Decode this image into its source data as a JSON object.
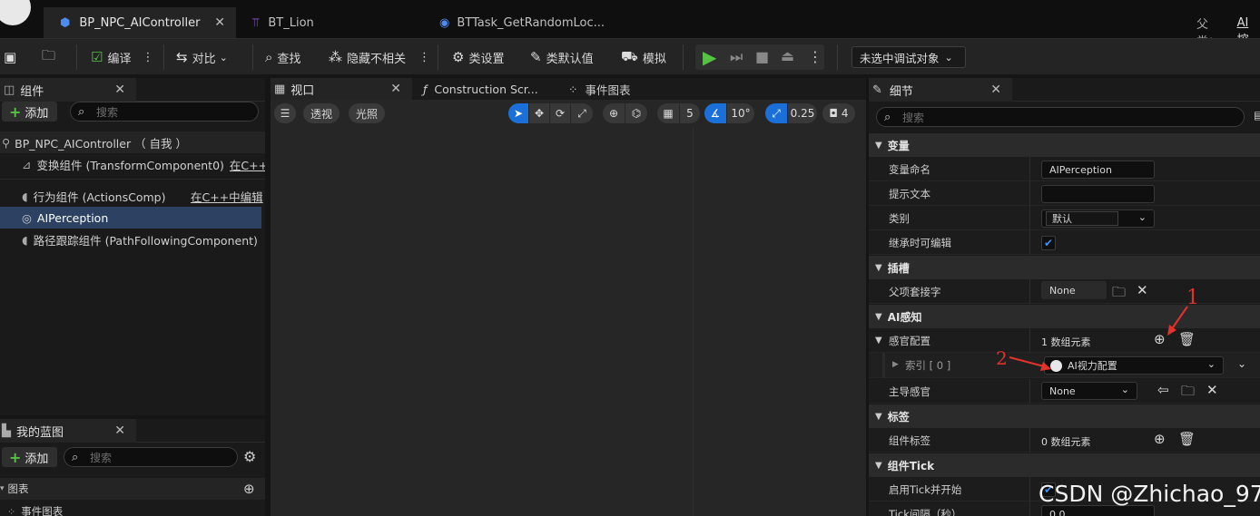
{
  "tabs": {
    "active": "BP_NPC_AIController",
    "second": "BT_Lion",
    "third": "BTTask_GetRandomLoc...",
    "parent_label": "父类：",
    "parent_value": "AI控"
  },
  "toolbar": {
    "compile": "编译",
    "diff": "对比",
    "find": "查找",
    "hide_unrelated": "隐藏不相关",
    "class_settings": "类设置",
    "class_defaults": "类默认值",
    "simulate": "模拟",
    "debug_target": "未选中调试对象"
  },
  "components": {
    "tab": "组件",
    "add": "添加",
    "search_placeholder": "搜索",
    "root": "BP_NPC_AIController （ 自我 ）",
    "items": [
      {
        "label": "变换组件 (TransformComponent0)",
        "link": "在C++中"
      },
      {
        "label": "行为组件 (ActionsComp)",
        "link": "在C++中编辑"
      },
      {
        "label": "AIPerception",
        "link": ""
      },
      {
        "label": "路径跟踪组件 (PathFollowingComponent)",
        "link": ""
      }
    ]
  },
  "my_blueprint": {
    "tab": "我的蓝图",
    "add": "添加",
    "search_placeholder": "搜索",
    "graphs": "图表",
    "event_graph": "事件图表"
  },
  "editor_tabs": {
    "viewport": "视口",
    "construction": "Construction Scr...",
    "event_graph": "事件图表"
  },
  "viewport": {
    "perspective": "透视",
    "lit": "光照",
    "grid_size": "5",
    "rotation_snap": "10°",
    "scale_snap": "0.25",
    "camera_speed": "4"
  },
  "details": {
    "tab": "细节",
    "search_placeholder": "搜索",
    "categories": {
      "variable": "变量",
      "socket": "插槽",
      "ai_perception": "AI感知",
      "tags": "标签",
      "component_tick": "组件Tick"
    },
    "props": {
      "var_name_label": "变量命名",
      "var_name_value": "AIPerception",
      "tooltip_label": "提示文本",
      "tooltip_value": "",
      "category_label": "类别",
      "category_value": "默认",
      "editable_label": "继承时可编辑",
      "parent_socket_label": "父项套接字",
      "parent_socket_value": "None",
      "senses_config_label": "感官配置",
      "senses_config_value": "1 数组元素",
      "index_label": "索引 [ 0 ]",
      "index_value": "AI视力配置",
      "dominant_sense_label": "主导感官",
      "dominant_sense_value": "None",
      "component_tags_label": "组件标签",
      "component_tags_value": "0 数组元素",
      "start_with_tick_label": "启用Tick并开始",
      "tick_interval_label": "Tick间隔（秒）",
      "tick_interval_value": "0.0"
    },
    "editable_checked": true
  },
  "annotations": {
    "one": "1",
    "two": "2"
  },
  "watermark": "CSDN @Zhichao_97",
  "colors": {
    "accent": "#1a6fd8",
    "play": "#55c244",
    "annotation": "#e4322b"
  }
}
